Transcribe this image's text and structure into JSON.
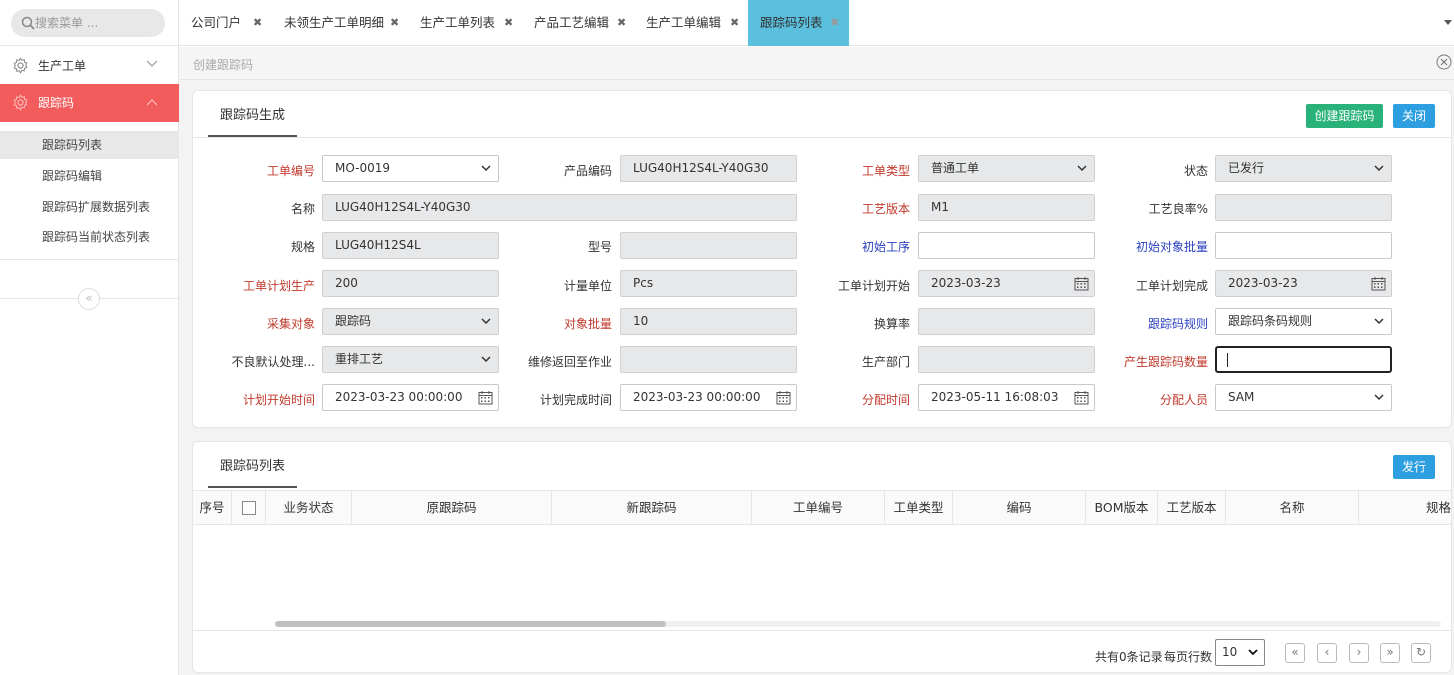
{
  "sidebar": {
    "search_placeholder": "搜索菜单 ...",
    "menu": [
      {
        "label": "生产工单",
        "icon": "gear-icon",
        "expanded": false
      },
      {
        "label": "跟踪码",
        "icon": "gear-icon",
        "expanded": true
      }
    ],
    "subitems": [
      "跟踪码列表",
      "跟踪码编辑",
      "跟踪码扩展数据列表",
      "跟踪码当前状态列表"
    ],
    "collapse_glyph": "«"
  },
  "tabs": [
    {
      "label": "公司门户",
      "close": "✖"
    },
    {
      "label": "未领生产工单明细",
      "close": "✖"
    },
    {
      "label": "生产工单列表",
      "close": "✖"
    },
    {
      "label": "产品工艺编辑",
      "close": "✖"
    },
    {
      "label": "生产工单编辑",
      "close": "✖"
    },
    {
      "label": "跟踪码列表",
      "close": "✖",
      "active": true
    }
  ],
  "content_title": "创建跟踪码",
  "form_panel": {
    "tab": "跟踪码生成",
    "create_button": "创建跟踪码",
    "close_button": "关闭",
    "fields": [
      {
        "label": "工单编号",
        "value": "MO-0019",
        "type": "select"
      },
      {
        "label": "产品编码",
        "value": "LUG40H12S4L-Y40G30",
        "type": "readonly"
      },
      {
        "label": "工单类型",
        "value": "普通工单",
        "type": "select-ro"
      },
      {
        "label": "状态",
        "value": "已发行",
        "type": "select-ro"
      },
      {
        "label": "名称",
        "value": "LUG40H12S4L-Y40G30",
        "type": "readonly"
      },
      {
        "label": "工艺版本",
        "value": "M1",
        "type": "readonly"
      },
      {
        "label": "工艺良率%",
        "value": "",
        "type": "readonly"
      },
      {
        "label": "规格",
        "value": "LUG40H12S4L",
        "type": "readonly"
      },
      {
        "label": "型号",
        "value": "",
        "type": "readonly"
      },
      {
        "label": "初始工序",
        "value": "",
        "type": "input"
      },
      {
        "label": "初始对象批量",
        "value": "",
        "type": "input"
      },
      {
        "label": "工单计划生产",
        "value": "200",
        "type": "readonly"
      },
      {
        "label": "计量单位",
        "value": "Pcs",
        "type": "readonly"
      },
      {
        "label": "工单计划开始",
        "value": "2023-03-23",
        "type": "date-ro"
      },
      {
        "label": "工单计划完成",
        "value": "2023-03-23",
        "type": "date-ro"
      },
      {
        "label": "采集对象",
        "value": "跟踪码",
        "type": "select-ro"
      },
      {
        "label": "对象批量",
        "value": "10",
        "type": "readonly"
      },
      {
        "label": "换算率",
        "value": "",
        "type": "readonly"
      },
      {
        "label": "跟踪码规则",
        "value": "跟踪码条码规则",
        "type": "select"
      },
      {
        "label": "不良默认处理...",
        "value": "重排工艺",
        "type": "select-ro"
      },
      {
        "label": "维修返回至作业",
        "value": "",
        "type": "readonly"
      },
      {
        "label": "生产部门",
        "value": "",
        "type": "readonly"
      },
      {
        "label": "产生跟踪码数量",
        "value": "",
        "type": "focus"
      },
      {
        "label": "计划开始时间",
        "value": "2023-03-23 00:00:00",
        "type": "date"
      },
      {
        "label": "计划完成时间",
        "value": "2023-03-23 00:00:00",
        "type": "date"
      },
      {
        "label": "分配时间",
        "value": "2023-05-11 16:08:03",
        "type": "date"
      },
      {
        "label": "分配人员",
        "value": "SAM",
        "type": "select"
      }
    ]
  },
  "list_panel": {
    "tab": "跟踪码列表",
    "publish_button": "发行",
    "columns": [
      "序号",
      "",
      "业务状态",
      "原跟踪码",
      "新跟踪码",
      "工单编号",
      "工单类型",
      "编码",
      "BOM版本",
      "工艺版本",
      "名称",
      "规格"
    ],
    "rows": [],
    "total_text": "共有0条记录",
    "page_size_label": "每页行数",
    "page_size": "10",
    "pager_buttons": [
      "«",
      "‹",
      "›",
      "»",
      "↻"
    ]
  },
  "colors": {
    "active_menu": "#f25c5c",
    "active_tab": "#5bc0de",
    "green_button": "#2ab27b",
    "blue_button": "#2d9fe0",
    "required_label": "#c0392b",
    "link_label": "#2a3fbf"
  }
}
